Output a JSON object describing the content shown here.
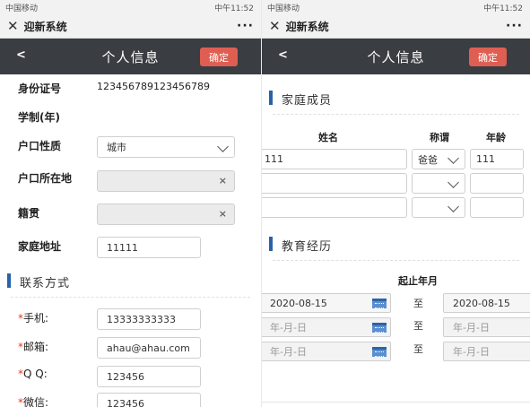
{
  "status": {
    "left": "中国移动",
    "right": "中午11:52"
  },
  "wechat": {
    "close_icon": "close-icon",
    "title": "迎新系统",
    "more": "···"
  },
  "nav": {
    "back": "<",
    "title": "个人信息",
    "confirm": "确定"
  },
  "left": {
    "id_label": "身份证号",
    "id_value": "123456789123456789",
    "school_label": "学制(年)",
    "hukou_type_label": "户口性质",
    "hukou_type_value": "城市",
    "hukou_loc_label": "户口所在地",
    "native_label": "籍贯",
    "address_label": "家庭地址",
    "address_value": "11111",
    "contact_section": "联系方式",
    "phone_label": "手机:",
    "phone_value": "13333333333",
    "email_label": "邮箱:",
    "email_value": "ahau@ahau.com",
    "qq_label": "Q Q:",
    "qq_value": "123456",
    "wechat_label": "微信:",
    "wechat_value": "123456",
    "required_mark": "*",
    "clear_mark": "×"
  },
  "right": {
    "family_section": "家庭成员",
    "col_name": "姓名",
    "col_relation": "称谓",
    "col_age": "年龄",
    "rows": [
      {
        "name": "111",
        "relation": "爸爸",
        "age": "111"
      },
      {
        "name": "",
        "relation": "",
        "age": ""
      },
      {
        "name": "",
        "relation": "",
        "age": ""
      }
    ],
    "edu_section": "教育经历",
    "col_period": "起止年月",
    "to": "至",
    "dates": [
      {
        "start": "2020-08-15",
        "end": "2020-08-15"
      },
      {
        "start": "年-月-日",
        "end": "年-月-日"
      },
      {
        "start": "年-月-日",
        "end": "年-月-日"
      }
    ]
  }
}
